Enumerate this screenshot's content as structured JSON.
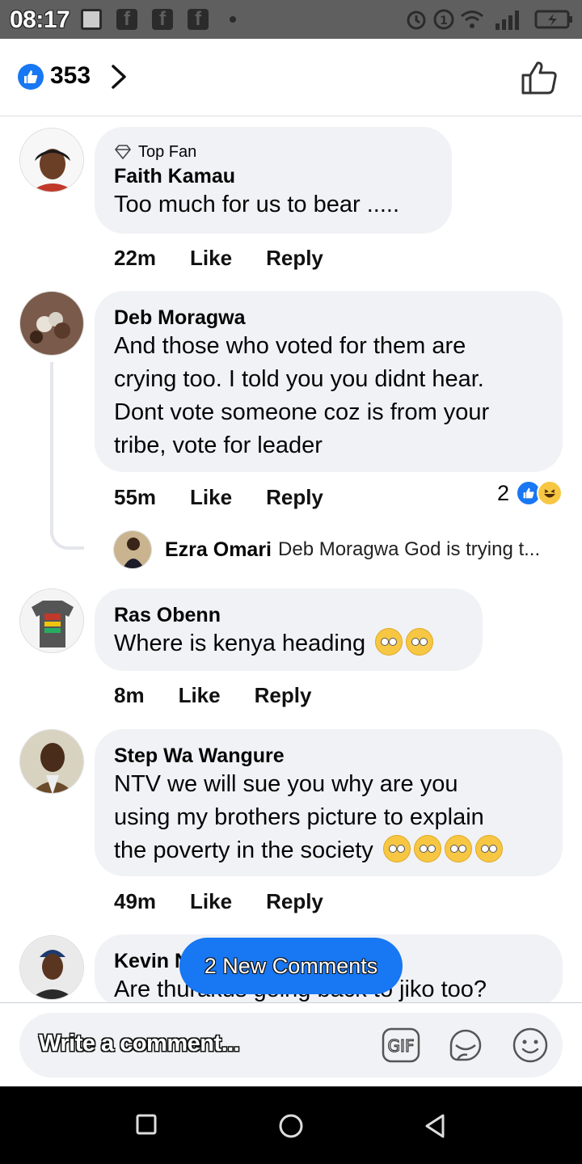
{
  "status": {
    "time": "08:17"
  },
  "header": {
    "like_count": "353"
  },
  "comments": [
    {
      "top_fan": "Top Fan",
      "name": "Faith Kamau",
      "lines": [
        "Too much for us to bear ....."
      ],
      "time": "22m",
      "like": "Like",
      "reply": "Reply"
    },
    {
      "name": "Deb Moragwa",
      "lines": [
        "And those who voted for them are",
        "crying too. I told you you didnt hear.",
        "Dont vote someone coz is from your",
        "tribe, vote  for leader"
      ],
      "time": "55m",
      "like": "Like",
      "reply": "Reply",
      "reaction_count": "2",
      "reply_preview": {
        "name": "Ezra Omari",
        "text": "Deb Moragwa God is trying t..."
      }
    },
    {
      "name": "Ras Obenn",
      "lines": [
        "Where is kenya heading"
      ],
      "time": "8m",
      "like": "Like",
      "reply": "Reply"
    },
    {
      "name": "Step Wa Wangure",
      "lines": [
        "NTV we will sue you why are you",
        "using my brothers picture to explain",
        "the poverty in the society"
      ],
      "time": "49m",
      "like": "Like",
      "reply": "Reply"
    },
    {
      "name": "Kevin N",
      "lines": [
        "Are thurakus going back to jiko too?"
      ]
    }
  ],
  "new_comments": "2 New Comments",
  "composer": {
    "placeholder": "Write a comment...",
    "gif": "GIF"
  }
}
